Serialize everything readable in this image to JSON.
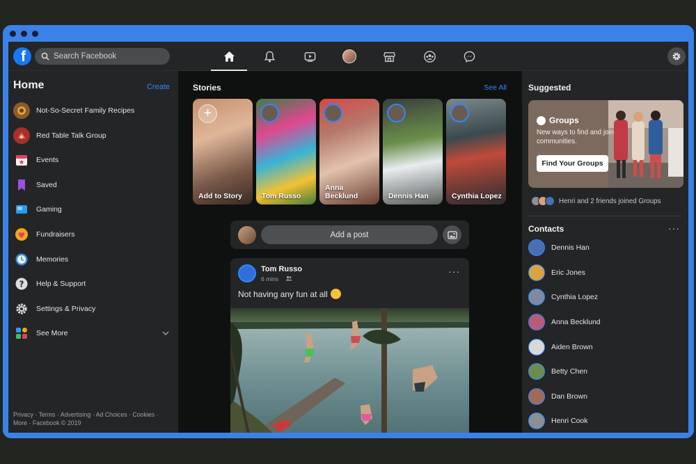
{
  "topbar": {
    "logo": "f",
    "search_placeholder": "Search Facebook",
    "nav_icons": [
      "home-icon",
      "bell-icon",
      "watch-icon",
      "profile-avatar",
      "marketplace-icon",
      "groups-icon",
      "messenger-icon"
    ],
    "settings_icon": "gear-icon"
  },
  "left": {
    "title": "Home",
    "create_label": "Create",
    "items": [
      {
        "label": "Not-So-Secret Family Recipes",
        "icon": "group-photo-icon"
      },
      {
        "label": "Red Table Talk Group",
        "icon": "group-photo-icon"
      },
      {
        "label": "Events",
        "icon": "calendar-icon"
      },
      {
        "label": "Saved",
        "icon": "bookmark-icon"
      },
      {
        "label": "Gaming",
        "icon": "gaming-icon"
      },
      {
        "label": "Fundraisers",
        "icon": "heart-icon"
      },
      {
        "label": "Memories",
        "icon": "clock-icon"
      },
      {
        "label": "Help & Support",
        "icon": "help-icon"
      },
      {
        "label": "Settings & Privacy",
        "icon": "gear-icon"
      },
      {
        "label": "See More",
        "icon": "see-more-icon"
      }
    ],
    "footer_line1": "Privacy · Terms · Advertising · Ad Choices · Cookies ·",
    "footer_line2": "More · Facebook © 2019"
  },
  "stories": {
    "title": "Stories",
    "see_all": "See All",
    "items": [
      {
        "name": "Add to Story"
      },
      {
        "name": "Tom Russo"
      },
      {
        "name": "Anna Becklund"
      },
      {
        "name": "Dennis Han"
      },
      {
        "name": "Cynthia Lopez"
      }
    ]
  },
  "composer": {
    "placeholder": "Add a post"
  },
  "post": {
    "author": "Tom Russo",
    "time": "6 mins",
    "text": "Not having any fun at all",
    "more": "···"
  },
  "right": {
    "suggested_title": "Suggested",
    "groups_card": {
      "title": "Groups",
      "description": "New ways to find and join communities.",
      "button": "Find Your Groups"
    },
    "joined_text": "Henri and 2 friends joined Groups",
    "contacts_title": "Contacts",
    "contacts_more": "···",
    "contacts": [
      {
        "name": "Dennis Han",
        "color": "#4a6fb0"
      },
      {
        "name": "Eric Jones",
        "color": "#d9a441"
      },
      {
        "name": "Cynthia Lopez",
        "color": "#7e8aa3"
      },
      {
        "name": "Anna Becklund",
        "color": "#b85a7a"
      },
      {
        "name": "Aiden Brown",
        "color": "#d8d8d8"
      },
      {
        "name": "Betty Chen",
        "color": "#6d8b4e"
      },
      {
        "name": "Dan Brown",
        "color": "#a06a5a"
      },
      {
        "name": "Henri Cook",
        "color": "#8c8f95"
      }
    ]
  },
  "colors": {
    "accent": "#2d88ff",
    "brand": "#1877f2",
    "frame": "#3b82e8"
  }
}
